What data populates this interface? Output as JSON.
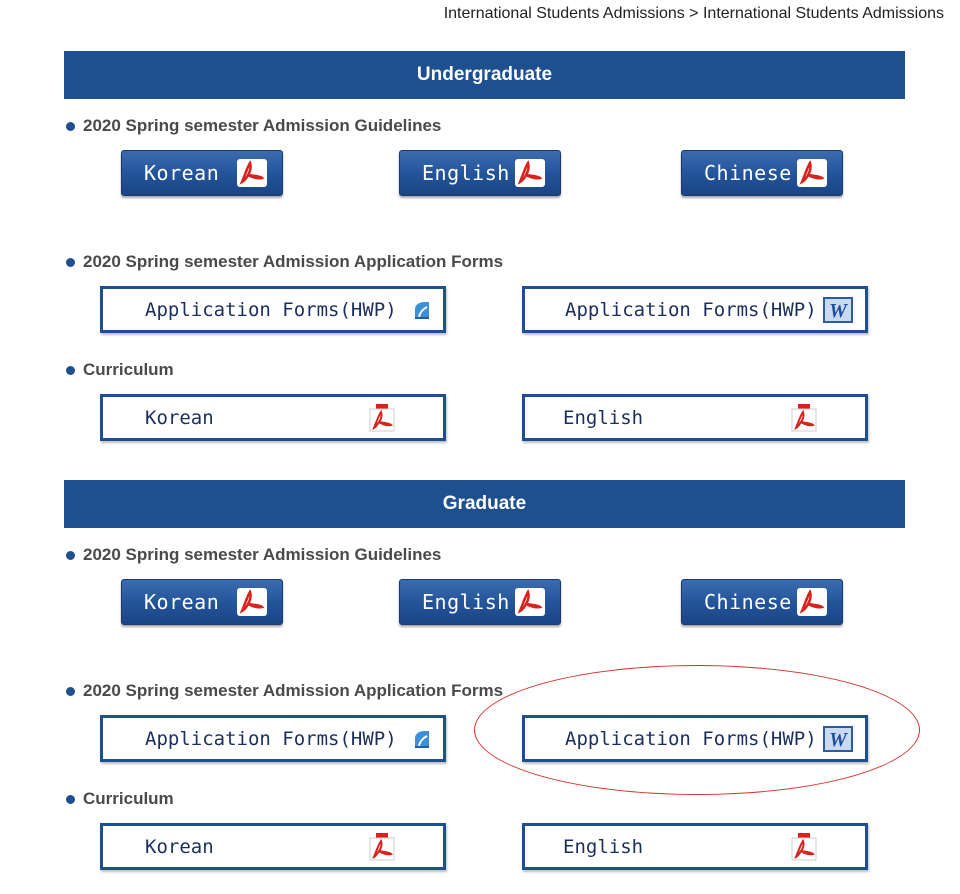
{
  "breadcrumb": "International Students Admissions > International Students Admissions",
  "undergraduate": {
    "title": "Undergraduate",
    "guidelines_heading": "2020 Spring semester Admission Guidelines",
    "guidelines_buttons": [
      "Korean",
      "English",
      "Chinese"
    ],
    "forms_heading": "2020 Spring semester Admission Application Forms",
    "forms_buttons": [
      "Application Forms(HWP)",
      "Application Forms(HWP)"
    ],
    "curriculum_heading": "Curriculum",
    "curriculum_buttons": [
      "Korean",
      "English"
    ]
  },
  "graduate": {
    "title": "Graduate",
    "guidelines_heading": "2020 Spring semester Admission Guidelines",
    "guidelines_buttons": [
      "Korean",
      "English",
      "Chinese"
    ],
    "forms_heading": "2020 Spring semester Admission Application Forms",
    "forms_buttons": [
      "Application Forms(HWP)",
      "Application Forms(HWP)"
    ],
    "curriculum_heading": "Curriculum",
    "curriculum_buttons": [
      "Korean",
      "English"
    ]
  },
  "icons": {
    "pdf": "pdf-icon",
    "hwp": "hwp-file-icon",
    "word": "word-doc-icon"
  },
  "colors": {
    "section_bar": "#1e4f8f",
    "button_dark": "#24549a",
    "annotation": "#d4302b",
    "pdf_red": "#d9221c"
  }
}
